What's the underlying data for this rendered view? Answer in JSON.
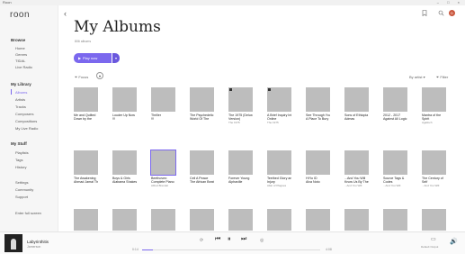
{
  "window": {
    "title": "Roon",
    "controls": "– □ ×"
  },
  "sidebar": {
    "logo": "roon",
    "browse_heading": "Browse",
    "browse_items": [
      "Home",
      "Genres",
      "TIDAL",
      "Live Radio"
    ],
    "library_heading": "My Library",
    "library_items": [
      "Albums",
      "Artists",
      "Tracks",
      "Composers",
      "Compositions",
      "My Live Radio"
    ],
    "stuff_heading": "My Stuff",
    "stuff_items": [
      "Playlists",
      "Tags",
      "History"
    ],
    "bottom_items": [
      "Settings",
      "Community",
      "Support"
    ],
    "full_screen": "Enter full screen",
    "active_item": "Albums"
  },
  "header": {
    "back": "‹",
    "bookmark_icon": "bookmark-icon",
    "search_icon": "search-icon",
    "avatar": "D"
  },
  "page": {
    "title": "My Albums",
    "count": "806 albums",
    "play_label": "Play now",
    "focus_label": "Focus",
    "sort_label": "By artist",
    "filter_label": "Filter"
  },
  "albums": [
    {
      "t1": "Me and Quilted",
      "t2": "Down by the",
      "t3": ""
    },
    {
      "t1": "Louder Up Now",
      "t2": "!!!",
      "t3": ""
    },
    {
      "t1": "Thriller",
      "t2": "!!!",
      "t3": ""
    },
    {
      "t1": "The Psychedelic",
      "t2": "World Of The",
      "t3": ""
    },
    {
      "t1": "The 1975 (Deluxe",
      "t2": "Version)",
      "t3": "The 1975"
    },
    {
      "t1": "A Brief Inquiry Into",
      "t2": "Online",
      "t3": "The 1975"
    },
    {
      "t1": "See Through You",
      "t2": "A Place To Bury",
      "t3": ""
    },
    {
      "t1": "Sons of Ethiopia",
      "t2": "Admas",
      "t3": ""
    },
    {
      "t1": "2012 - 2017",
      "t2": "Against All Logic",
      "t3": ""
    },
    {
      "t1": "Mantra of the",
      "t2": "Spirit",
      "t3": "Agalloch"
    },
    {
      "t1": "The Awakening",
      "t2": "Ahmad Jamal The",
      "t3": ""
    },
    {
      "t1": "Boys & Girls",
      "t2": "Alabama Shakes",
      "t3": ""
    },
    {
      "t1": "Beethoven:",
      "t2": "Complete Piano",
      "t3": "Alfred Brendel"
    },
    {
      "t1": "Cell A Peace",
      "t2": "The African Beats",
      "t3": ""
    },
    {
      "t1": "Forever Young",
      "t2": "Alphaville",
      "t3": ""
    },
    {
      "t1": "Teethed Glory and",
      "t2": "Injury",
      "t3": "Altar of Plagues"
    },
    {
      "t1": "HYIo ID",
      "t2": "Alva Noto",
      "t3": ""
    },
    {
      "t1": "...And You Will",
      "t2": "Know Us By The",
      "t3": "...And You Will"
    },
    {
      "t1": "Source Tags &",
      "t2": "Codes",
      "t3": "...And You Will"
    },
    {
      "t1": "The Century of",
      "t2": "Self",
      "t3": "...And You Will"
    }
  ],
  "player": {
    "track": "Labyrinthitis",
    "artist": "Jamerson",
    "time_elapsed": "0:14",
    "time_total": "4:08",
    "progress": 0.06,
    "zone": "Default Output"
  },
  "colors": {
    "accent": "#7b68ee",
    "cover": "#bdbdbd"
  }
}
